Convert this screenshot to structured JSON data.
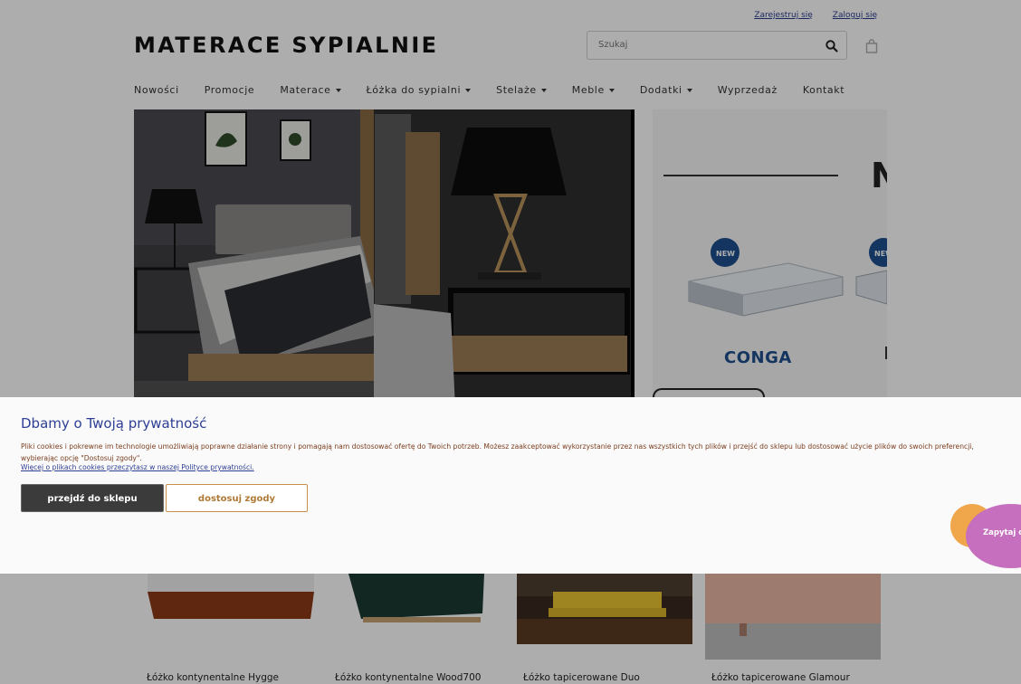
{
  "header": {
    "top_links": [
      "Zarejestruj się",
      "Zaloguj się"
    ],
    "logo": "MATERACE SYPIALNIE",
    "search_placeholder": "Szukaj",
    "icons": {
      "search": "search-icon",
      "cart": "shopping-bag-icon"
    }
  },
  "nav": {
    "items": [
      {
        "label": "Nowości"
      },
      {
        "label": "Promocje"
      },
      {
        "label": "Materace"
      },
      {
        "label": "Łóżka do sypialni"
      },
      {
        "label": "Stelaże"
      },
      {
        "label": "Meble"
      },
      {
        "label": "Dodatki"
      },
      {
        "label": "Wyprzedaż"
      },
      {
        "label": "Kontakt"
      }
    ]
  },
  "banner": {
    "badges": [
      "NEW",
      "NEW"
    ],
    "product_label": "CONGA"
  },
  "products": [
    {
      "name": "Łóżko kontynentalne Hygge"
    },
    {
      "name": "Łóżko kontynentalne Wood700"
    },
    {
      "name": "Łóżko tapicerowane Duo"
    },
    {
      "name": "Łóżko tapicerowane Glamour"
    }
  ],
  "cookie": {
    "title": "Dbamy o Twoją prywatność",
    "text": "Pliki cookies i pokrewne im technologie umożliwiają poprawne działanie strony i pomagają nam dostosować ofertę do Twoich potrzeb. Możesz zaakceptować wykorzystanie przez nas wszystkich tych plików i przejść do sklepu lub dostosować użycie plików do swoich preferencji, wybierając opcję \"Dostosuj zgody\".",
    "link": "Więcej o plikach cookies przeczytasz w naszej Polityce prywatności.",
    "accept_label": "przejdź do sklepu",
    "customize_label": "dostosuj zgody"
  },
  "chat": {
    "label": "Zapytaj o p"
  },
  "colors": {
    "accent_blue": "#2d3f95",
    "accept_bg": "#3b3b3b",
    "customize_border": "#c88f4b",
    "chat_purple": "#c66fbf",
    "chat_orange": "#f0a64a"
  }
}
